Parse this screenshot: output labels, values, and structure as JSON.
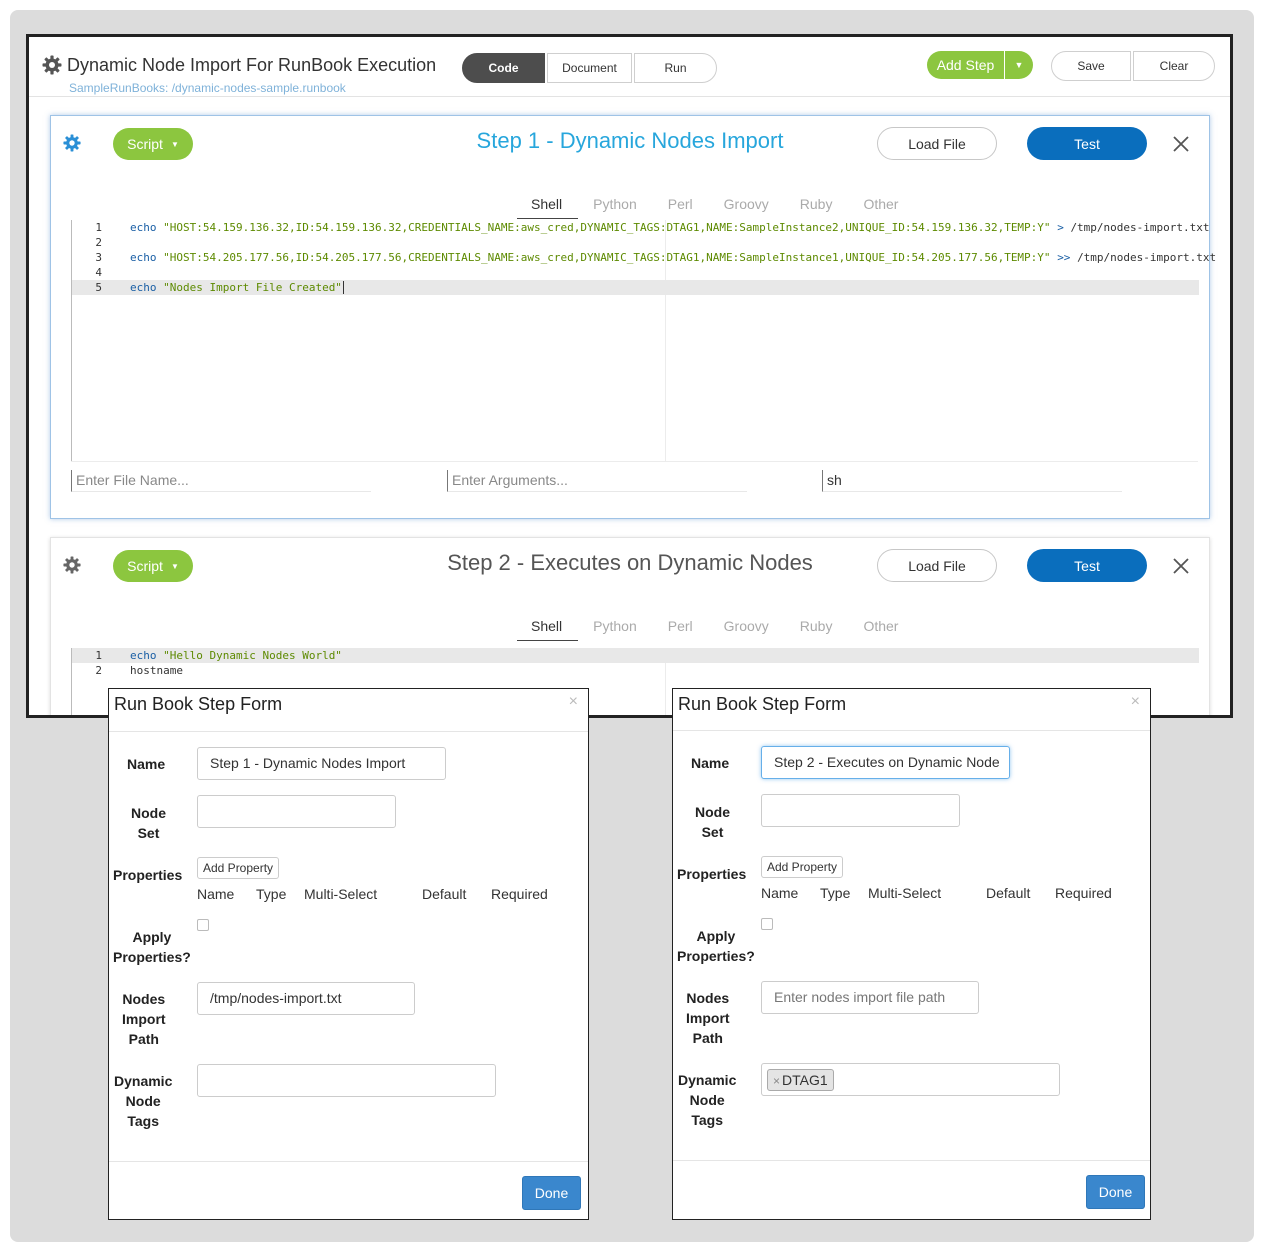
{
  "header": {
    "title": "Dynamic Node Import For RunBook Execution",
    "subtitle": "SampleRunBooks: /dynamic-nodes-sample.runbook",
    "tabs": {
      "code": "Code",
      "document": "Document",
      "run": "Run"
    },
    "add_step": "Add Step",
    "save": "Save",
    "clear": "Clear"
  },
  "step1": {
    "script_label": "Script",
    "title": "Step 1 - Dynamic Nodes Import",
    "load_file": "Load File",
    "test": "Test",
    "languages": [
      "Shell",
      "Python",
      "Perl",
      "Groovy",
      "Ruby",
      "Other"
    ],
    "active_language": "Shell",
    "code": {
      "l1_kw": "echo",
      "l1_str": "\"HOST:54.159.136.32,ID:54.159.136.32,CREDENTIALS_NAME:aws_cred,DYNAMIC_TAGS:DTAG1,NAME:SampleInstance2,UNIQUE_ID:54.159.136.32,TEMP:Y\"",
      "l1_op": ">",
      "l1_path": "/tmp/nodes-import.txt",
      "l3_kw": "echo",
      "l3_str": "\"HOST:54.205.177.56,ID:54.205.177.56,CREDENTIALS_NAME:aws_cred,DYNAMIC_TAGS:DTAG1,NAME:SampleInstance1,UNIQUE_ID:54.205.177.56,TEMP:Y\"",
      "l3_op": ">>",
      "l3_path": "/tmp/nodes-import.txt",
      "l5_kw": "echo",
      "l5_str": "\"Nodes Import File Created\"",
      "line_numbers": [
        "1",
        "2",
        "3",
        "4",
        "5"
      ]
    },
    "file_name_placeholder": "Enter File Name...",
    "arguments_placeholder": "Enter Arguments...",
    "interpreter": "sh"
  },
  "step2": {
    "script_label": "Script",
    "title": "Step 2 - Executes on Dynamic Nodes",
    "load_file": "Load File",
    "test": "Test",
    "languages": [
      "Shell",
      "Python",
      "Perl",
      "Groovy",
      "Ruby",
      "Other"
    ],
    "active_language": "Shell",
    "code": {
      "l1_kw": "echo",
      "l1_str": "\"Hello Dynamic Nodes World\"",
      "l2": "hostname",
      "line_numbers": [
        "1",
        "2"
      ]
    }
  },
  "form1": {
    "title": "Run Book Step Form",
    "close": "×",
    "labels": {
      "name": "Name",
      "node_set_1": "Node",
      "node_set_2": "Set",
      "properties": "Properties",
      "apply_1": "Apply",
      "apply_2": "Properties?",
      "nip_1": "Nodes",
      "nip_2": "Import",
      "nip_3": "Path",
      "dnt_1": "Dynamic",
      "dnt_2": "Node",
      "dnt_3": "Tags"
    },
    "name_value": "Step 1 - Dynamic Nodes Import",
    "node_set_value": "",
    "add_property": "Add Property",
    "columns": [
      "Name",
      "Type",
      "Multi-Select",
      "Default",
      "Required"
    ],
    "nodes_import_path_value": "/tmp/nodes-import.txt",
    "dynamic_tags": [],
    "done": "Done"
  },
  "form2": {
    "title": "Run Book Step Form",
    "close": "×",
    "labels": {
      "name": "Name",
      "node_set_1": "Node",
      "node_set_2": "Set",
      "properties": "Properties",
      "apply_1": "Apply",
      "apply_2": "Properties?",
      "nip_1": "Nodes",
      "nip_2": "Import",
      "nip_3": "Path",
      "dnt_1": "Dynamic",
      "dnt_2": "Node",
      "dnt_3": "Tags"
    },
    "name_value": "Step 2 - Executes on Dynamic Node",
    "node_set_value": "",
    "add_property": "Add Property",
    "columns": [
      "Name",
      "Type",
      "Multi-Select",
      "Default",
      "Required"
    ],
    "nodes_import_path_placeholder": "Enter nodes import file path",
    "dynamic_tags": [
      "DTAG1"
    ],
    "tag_remove": "×",
    "done": "Done"
  },
  "colors": {
    "accent_green": "#8cc63f",
    "test_blue": "#0a6ebd",
    "step_title_blue": "#27a6dc",
    "done_blue": "#3a87cd"
  },
  "icons": [
    "gear-icon",
    "caret-down-icon",
    "close-icon",
    "checkbox-icon",
    "tag-remove-icon"
  ]
}
